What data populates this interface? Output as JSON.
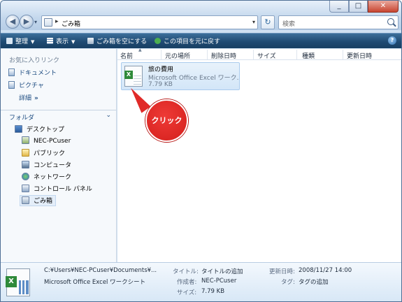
{
  "window": {
    "address": {
      "path_label": "ごみ箱"
    },
    "search": {
      "placeholder": "検索"
    }
  },
  "toolbar": {
    "organize_label": "整理",
    "views_label": "表示",
    "empty_label": "ごみ箱を空にする",
    "restore_label": "この項目を元に戻す"
  },
  "sidebar": {
    "favorites_header": "お気に入りリンク",
    "favorites": [
      {
        "label": "ドキュメント"
      },
      {
        "label": "ピクチャ"
      }
    ],
    "more_label": "詳細",
    "folders_header": "フォルダ",
    "tree": [
      {
        "label": "デスクトップ",
        "icon": "desktop-icon"
      },
      {
        "label": "NEC-PCuser",
        "icon": "user-folder-icon"
      },
      {
        "label": "パブリック",
        "icon": "folder-icon"
      },
      {
        "label": "コンピュータ",
        "icon": "computer-icon"
      },
      {
        "label": "ネットワーク",
        "icon": "network-icon"
      },
      {
        "label": "コントロール パネル",
        "icon": "control-panel-icon"
      },
      {
        "label": "ごみ箱",
        "icon": "recycle-bin-icon"
      }
    ]
  },
  "columns": [
    "名前",
    "元の場所",
    "削除日時",
    "サイズ",
    "種類",
    "更新日時"
  ],
  "file": {
    "name": "旅の費用",
    "type": "Microsoft Office Excel ワーク...",
    "size": "7.79 KB"
  },
  "callout": {
    "label": "クリック"
  },
  "details": {
    "path": "C:¥Users¥NEC-PCuser¥Documents¥...",
    "type": "Microsoft Office Excel ワークシート",
    "title_label": "タイトル:",
    "title_value": "タイトルの追加",
    "author_label": "作成者:",
    "author_value": "NEC-PCuser",
    "size_label": "サイズ:",
    "size_value": "7.79 KB",
    "modified_label": "更新日時:",
    "modified_value": "2008/11/27 14:00",
    "tags_label": "タグ:",
    "tags_value": "タグの追加"
  }
}
